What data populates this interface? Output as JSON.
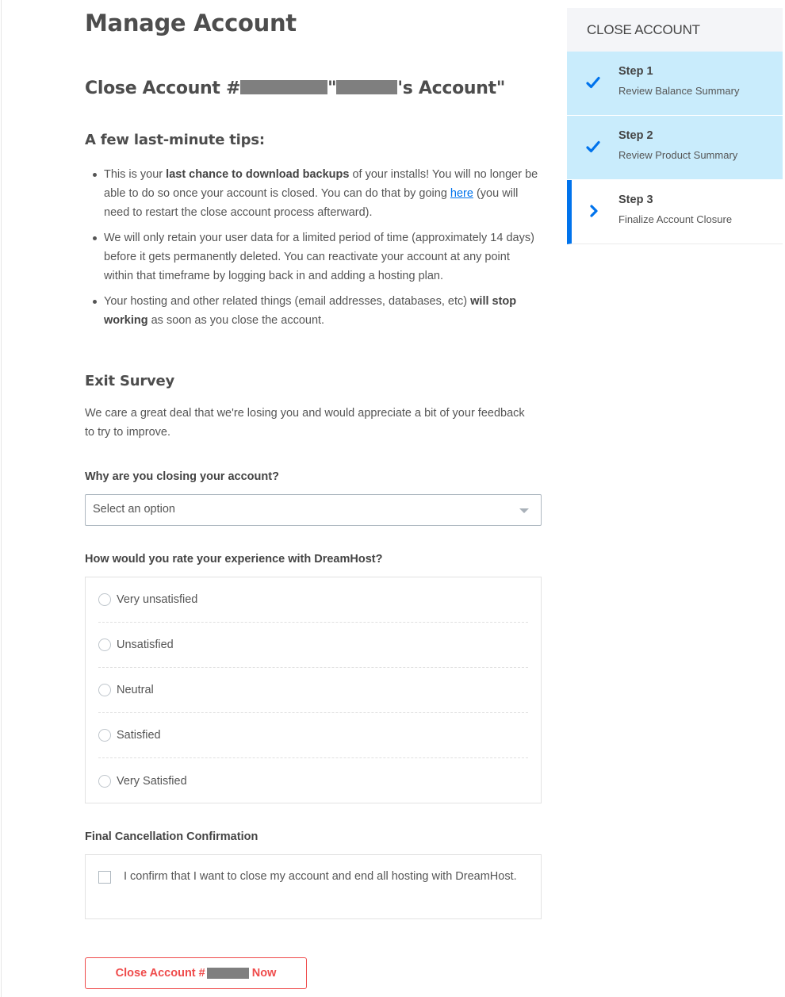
{
  "page": {
    "title": "Manage Account",
    "close_heading_prefix": "Close Account #",
    "close_heading_mid": "\"",
    "close_heading_suffix": "'s Account\""
  },
  "tips": {
    "heading": "A few last-minute tips:",
    "items": [
      {
        "pre": "This is your ",
        "bold": "last chance to download backups",
        "post": " of your installs! You will no longer be able to do so once your account is closed. You can do that by going ",
        "link": "here",
        "after": " (you will need to restart the close account process afterward)."
      },
      {
        "text": "We will only retain your user data for a limited period of time (approximately 14 days) before it gets permanently deleted. You can reactivate your account at any point within that timeframe by logging back in and adding a hosting plan."
      },
      {
        "pre": "Your hosting and other related things (email addresses, databases, etc) ",
        "bold": "will stop working",
        "post": " as soon as you close the account."
      }
    ]
  },
  "survey": {
    "heading": "Exit Survey",
    "description": "We care a great deal that we're losing you and would appreciate a bit of your feedback to try to improve.",
    "reason_label": "Why are you closing your account?",
    "reason_select": {
      "selected": "Select an option"
    },
    "rating_label": "How would you rate your experience with DreamHost?",
    "rating_options": [
      "Very unsatisfied",
      "Unsatisfied",
      "Neutral",
      "Satisfied",
      "Very Satisfied"
    ]
  },
  "confirmation": {
    "label": "Final Cancellation Confirmation",
    "checkbox_text": "I confirm that I want to close my account and end all hosting with DreamHost.",
    "checked": false
  },
  "close_button": {
    "prefix": "Close Account #",
    "suffix": "Now",
    "color": "#ef4b4b"
  },
  "sidebar": {
    "heading": "CLOSE ACCOUNT",
    "accent": "#0073ec",
    "done_bg": "#c9ecfc",
    "steps": [
      {
        "title": "Step 1",
        "description": "Review Balance Summary",
        "status": "done",
        "icon": "checkmark-icon"
      },
      {
        "title": "Step 2",
        "description": "Review Product Summary",
        "status": "done",
        "icon": "checkmark-icon"
      },
      {
        "title": "Step 3",
        "description": "Finalize Account Closure",
        "status": "current",
        "icon": "chevron-right-icon"
      }
    ]
  }
}
